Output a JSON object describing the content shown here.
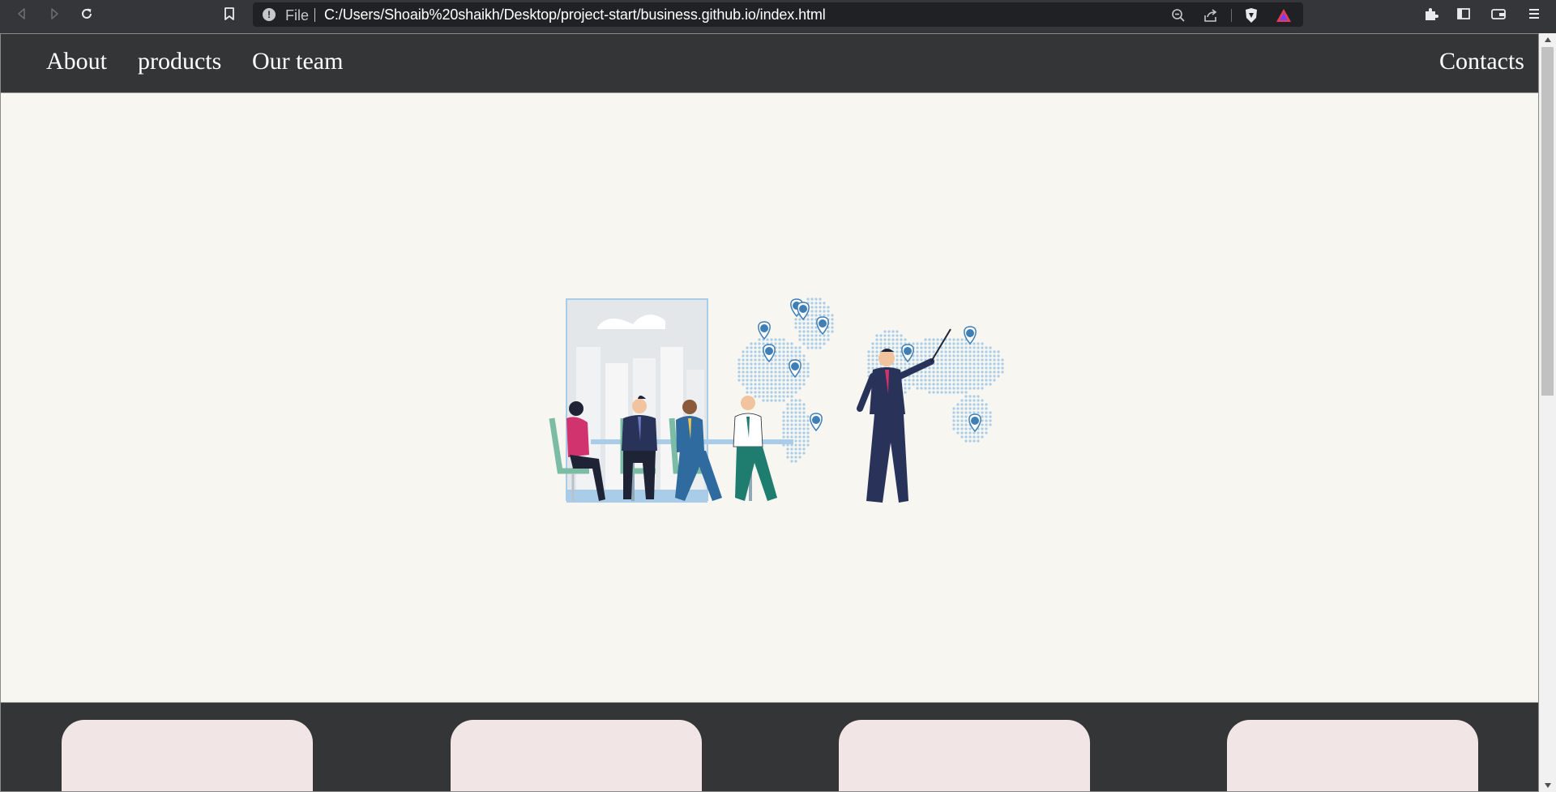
{
  "browser": {
    "address_bar": {
      "scheme_label": "File",
      "url": "C:/Users/Shoaib%20shaikh/Desktop/project-start/business.github.io/index.html"
    },
    "icons": [
      "back-icon",
      "forward-icon",
      "reload-icon",
      "bookmark-icon",
      "info-icon",
      "zoom-out-icon",
      "share-icon",
      "brave-shield-icon",
      "brave-rewards-icon",
      "extensions-icon",
      "sidebar-icon",
      "wallet-icon",
      "menu-icon"
    ]
  },
  "navbar": {
    "links": {
      "about": "About",
      "products": "products",
      "our_team": "Our team",
      "contacts": "Contacts"
    }
  },
  "hero": {
    "illustration": "business-meeting-world-map-illustration"
  },
  "cards": {
    "count": 4
  },
  "colors": {
    "chrome_bg": "#35363a",
    "omnibox_bg": "#202124",
    "navbar_bg": "#343536",
    "hero_bg": "#f7f6f1",
    "card_bg": "#f2e5e5",
    "map_dots": "#a9cde8",
    "pin": "#3f7fb5"
  }
}
